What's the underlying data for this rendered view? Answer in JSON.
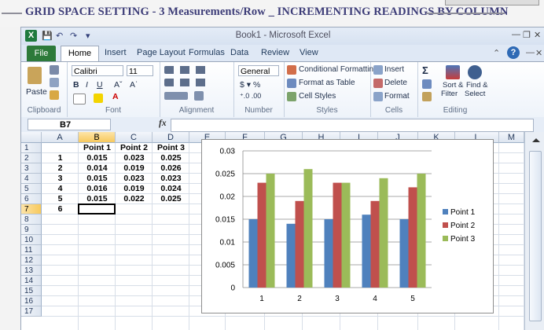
{
  "outer_title": "GRID SPACE SETTING - 3 Measurements/Row _ INCREMENTING READINGS BY COLUMN",
  "window": {
    "title": "Book1 - Microsoft Excel"
  },
  "tabs": [
    "File",
    "Home",
    "Insert",
    "Page Layout",
    "Formulas",
    "Data",
    "Review",
    "View"
  ],
  "ribbon": {
    "clipboard": {
      "label": "Clipboard",
      "paste": "Paste"
    },
    "font": {
      "label": "Font",
      "name": "Calibri",
      "size": "11"
    },
    "alignment": {
      "label": "Alignment"
    },
    "number": {
      "label": "Number",
      "format": "General"
    },
    "styles": {
      "label": "Styles",
      "conditional": "Conditional Formatting",
      "table": "Format as Table",
      "cell": "Cell Styles"
    },
    "cells": {
      "label": "Cells",
      "insert": "Insert",
      "delete": "Delete",
      "format": "Format"
    },
    "editing": {
      "label": "Editing",
      "sort": "Sort &",
      "sort2": "Filter",
      "find": "Find &",
      "find2": "Select"
    }
  },
  "formula_bar": {
    "name_box": "B7",
    "fx": "fx",
    "value": ""
  },
  "sheet": {
    "columns": [
      "A",
      "B",
      "C",
      "D",
      "E",
      "F",
      "G",
      "H",
      "I",
      "J",
      "K",
      "L",
      "M"
    ],
    "rows": [
      "1",
      "2",
      "3",
      "4",
      "5",
      "6",
      "7",
      "8",
      "9",
      "10",
      "11",
      "12",
      "13",
      "14",
      "15",
      "16",
      "17"
    ],
    "selected_cell": "B7",
    "header_row": [
      "Point 1",
      "Point 2",
      "Point 3"
    ],
    "data_rows": [
      {
        "n": "1",
        "p1": "0.015",
        "p2": "0.023",
        "p3": "0.025"
      },
      {
        "n": "2",
        "p1": "0.014",
        "p2": "0.019",
        "p3": "0.026"
      },
      {
        "n": "3",
        "p1": "0.015",
        "p2": "0.023",
        "p3": "0.023"
      },
      {
        "n": "4",
        "p1": "0.016",
        "p2": "0.019",
        "p3": "0.024"
      },
      {
        "n": "5",
        "p1": "0.015",
        "p2": "0.022",
        "p3": "0.025"
      }
    ],
    "extra_row_label": "6"
  },
  "colors": {
    "point1": "#4f81bd",
    "point2": "#c0504d",
    "point3": "#9bbb59"
  },
  "chart_data": {
    "type": "bar",
    "categories": [
      "1",
      "2",
      "3",
      "4",
      "5"
    ],
    "series": [
      {
        "name": "Point 1",
        "values": [
          0.015,
          0.014,
          0.015,
          0.016,
          0.015
        ]
      },
      {
        "name": "Point 2",
        "values": [
          0.023,
          0.019,
          0.023,
          0.019,
          0.022
        ]
      },
      {
        "name": "Point 3",
        "values": [
          0.025,
          0.026,
          0.023,
          0.024,
          0.025
        ]
      }
    ],
    "yticks": [
      "0",
      "0.005",
      "0.01",
      "0.015",
      "0.02",
      "0.025",
      "0.03"
    ],
    "ylim": [
      0,
      0.03
    ],
    "grid": true,
    "legend": "right"
  }
}
